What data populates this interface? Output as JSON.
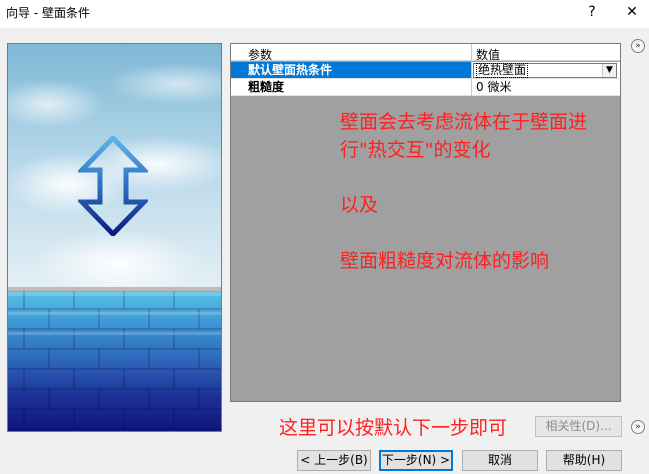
{
  "window": {
    "title": "向导 - 壁面条件",
    "help_label": "?",
    "close_label": "✕"
  },
  "grid": {
    "col_param": "参数",
    "col_value": "数值",
    "rows": [
      {
        "name": "默认壁面热条件",
        "value": "绝热壁面"
      },
      {
        "name": "粗糙度",
        "value": "0 微米"
      }
    ]
  },
  "annotations": {
    "line1": "壁面会去考虑流体在于壁面进",
    "line2": "行\"热交互\"的变化",
    "line3": "以及",
    "line4": "壁面粗糙度对流体的影响",
    "bottom_note": "这里可以按默认下一步即可"
  },
  "buttons": {
    "relevance": "相关性(D)...",
    "prev": "< 上一步(B)",
    "next": "下一步(N) >",
    "cancel": "取消",
    "help": "帮助(H)"
  },
  "icons": {
    "collapse_top": "double-chevron-right-icon",
    "collapse_bottom": "double-chevron-right-icon",
    "arrow": "up-down-arrow-icon"
  }
}
